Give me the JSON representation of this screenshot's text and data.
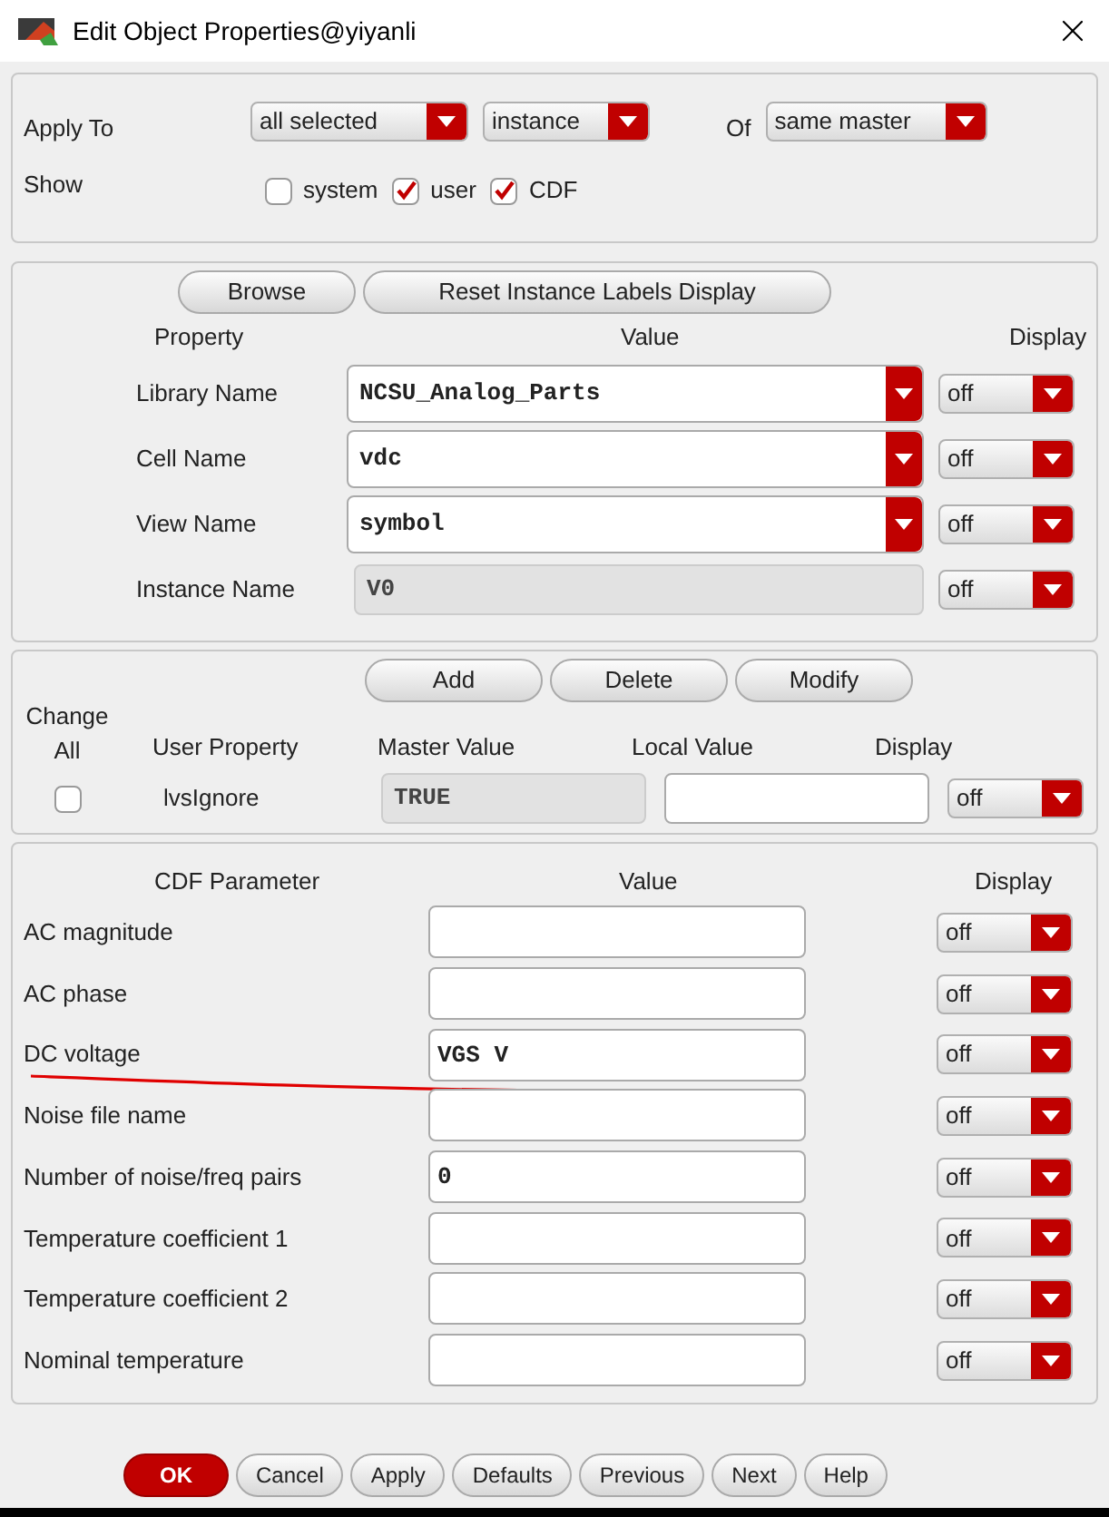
{
  "window": {
    "title": "Edit Object Properties@yiyanli"
  },
  "apply_to": {
    "label": "Apply To",
    "scope": "all selected",
    "type": "instance",
    "of_label": "Of",
    "of": "same master"
  },
  "show": {
    "label": "Show",
    "options": [
      {
        "label": "system",
        "checked": false
      },
      {
        "label": "user",
        "checked": true
      },
      {
        "label": "CDF",
        "checked": true
      }
    ]
  },
  "properties": {
    "buttons": [
      "Browse",
      "Reset Instance Labels Display"
    ],
    "columns": [
      "Property",
      "Value",
      "Display"
    ],
    "rows": [
      {
        "name": "Library Name",
        "value": "NCSU_Analog_Parts",
        "kind": "combo",
        "display": "off"
      },
      {
        "name": "Cell Name",
        "value": "vdc",
        "kind": "combo",
        "display": "off"
      },
      {
        "name": "View Name",
        "value": "symbol",
        "kind": "combo",
        "display": "off"
      },
      {
        "name": "Instance Name",
        "value": "V0",
        "kind": "readonly",
        "display": "off"
      }
    ]
  },
  "user_properties": {
    "buttons": [
      "Add",
      "Delete",
      "Modify"
    ],
    "change_all": {
      "label": "Change All",
      "checked": false
    },
    "columns": [
      "User Property",
      "Master Value",
      "Local Value",
      "Display"
    ],
    "rows": [
      {
        "name": "lvsIgnore",
        "master": "TRUE",
        "display": "off"
      }
    ]
  },
  "cdf": {
    "columns": [
      "CDF Parameter",
      "Value",
      "Display"
    ],
    "rows": [
      {
        "name": "AC magnitude",
        "display": "off",
        "annotated": false
      },
      {
        "name": "AC phase",
        "display": "off",
        "annotated": false
      },
      {
        "name": "DC voltage",
        "value": "VGS V",
        "display": "off",
        "annotated": true
      },
      {
        "name": "Noise file name",
        "display": "off",
        "annotated": false
      },
      {
        "name": "Number of noise/freq pairs",
        "value": "0",
        "display": "off",
        "annotated": false
      },
      {
        "name": "Temperature coefficient 1",
        "display": "off",
        "annotated": false
      },
      {
        "name": "Temperature coefficient 2",
        "display": "off",
        "annotated": false
      },
      {
        "name": "Nominal temperature",
        "display": "off",
        "annotated": false
      }
    ]
  },
  "buttons": [
    {
      "label": "OK",
      "primary": true
    },
    {
      "label": "Cancel",
      "primary": false
    },
    {
      "label": "Apply",
      "primary": false
    },
    {
      "label": "Defaults",
      "primary": false
    },
    {
      "label": "Previous",
      "primary": false
    },
    {
      "label": "Next",
      "primary": false
    },
    {
      "label": "Help",
      "primary": false
    }
  ]
}
